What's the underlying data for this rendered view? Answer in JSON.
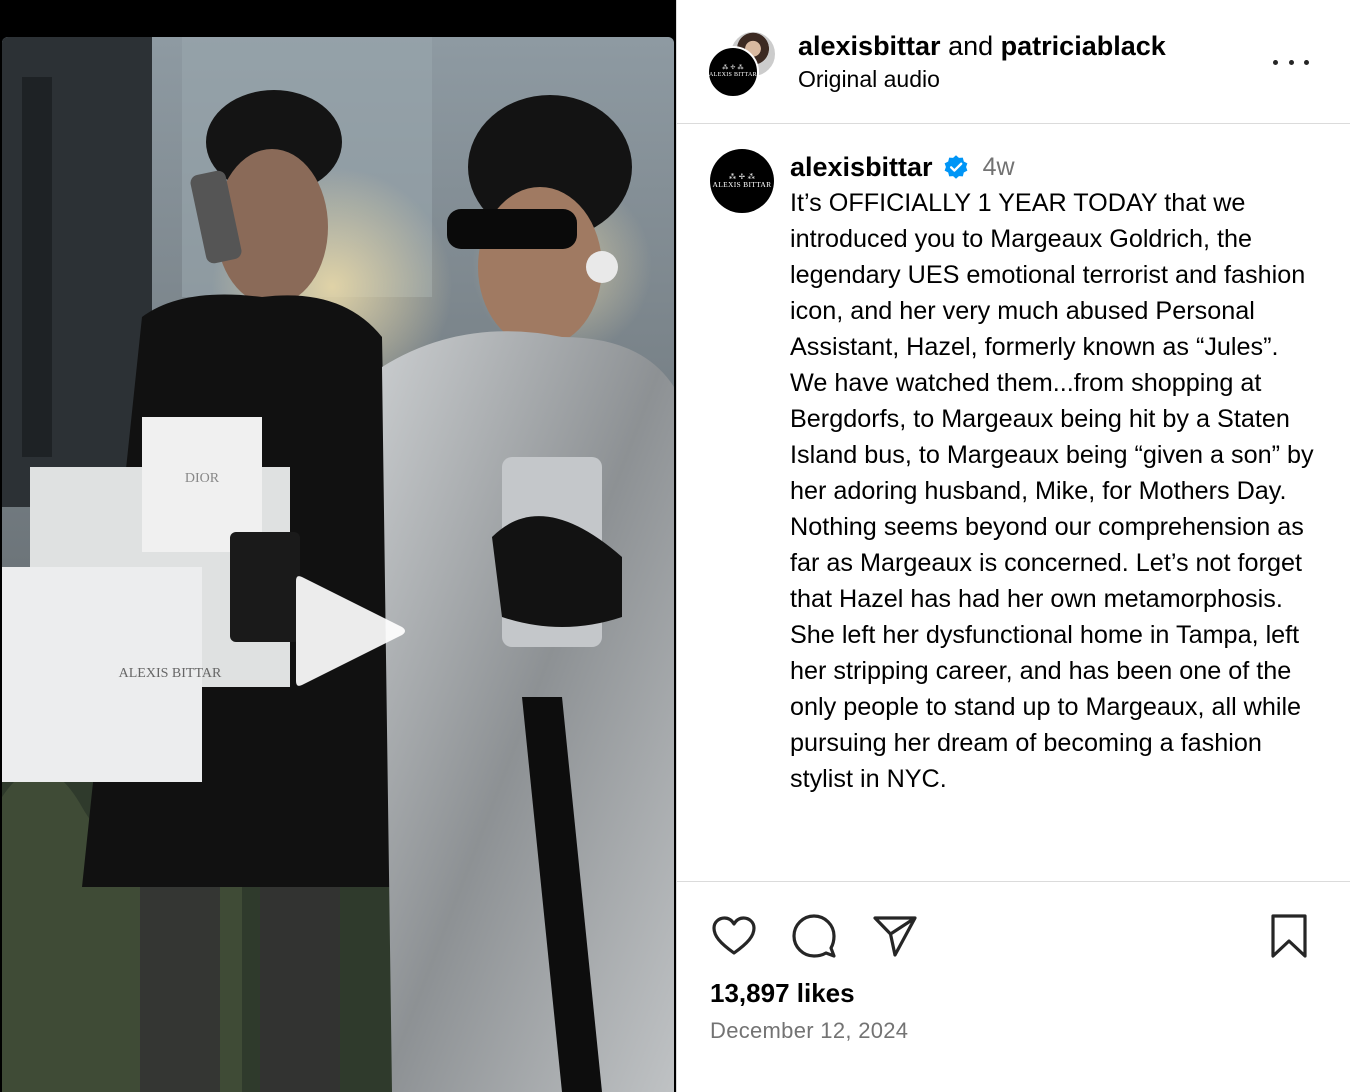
{
  "header": {
    "user1": "alexisbittar",
    "joiner": "and",
    "user2": "patriciablack",
    "audio": "Original audio"
  },
  "logo": {
    "mark": "⁂ ✢ ⁂",
    "text": "ALEXIS BITTAR"
  },
  "caption": {
    "username": "alexisbittar",
    "time": "4w",
    "text": "It’s OFFICIALLY 1 YEAR TODAY that we introduced you to Margeaux Goldrich, the legendary UES emotional terrorist and fashion icon, and her very much abused Personal Assistant, Hazel, formerly known as “Jules”. We have watched them...from shopping at Bergdorfs, to Margeaux being hit by a Staten Island bus, to Margeaux being “given a son” by her adoring husband, Mike, for Mothers Day. Nothing seems beyond our comprehension as far as Margeaux is concerned. Let’s not forget that Hazel has had her own metamorphosis. She left her dysfunctional home in Tampa, left her stripping career, and has been one of the only people to stand up to Margeaux, all while pursuing her dream of becoming a fashion stylist in NYC."
  },
  "media": {
    "bag_brand_1": "DIOR",
    "bag_brand_2": "ALEXIS BITTAR"
  },
  "stats": {
    "likes": "13,897 likes",
    "date": "December 12, 2024"
  },
  "icons": {
    "like": "heart-icon",
    "comment": "comment-icon",
    "share": "paper-plane-icon",
    "save": "bookmark-icon",
    "play": "play-icon",
    "more": "more-dots-icon",
    "verified": "verified-badge-icon"
  },
  "colors": {
    "verified": "#0095f6",
    "muted": "#737373",
    "divider": "#dbdbdb"
  }
}
